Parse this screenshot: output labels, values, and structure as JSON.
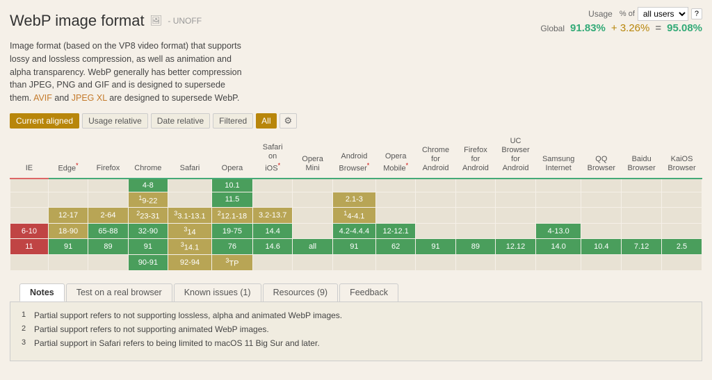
{
  "header": {
    "title": "WebP image format",
    "icon_label": "image-icon",
    "unoff": "- UNOFF",
    "usage_label": "Usage",
    "users_label": "% of  all users",
    "question": "?",
    "global_label": "Global",
    "global_pct1": "91.83%",
    "global_plus": "+ 3.26%",
    "global_eq": "=",
    "global_total": "95.08%"
  },
  "description": {
    "text1": "Image format (based on the VP8 video format) that supports lossy and lossless compression, as well as animation and alpha transparency. WebP generally has better compression than JPEG, PNG and GIF and is designed to supersede them.",
    "link1": "AVIF",
    "text2": " and ",
    "link2": "JPEG XL",
    "text3": " are designed to supersede WebP."
  },
  "controls": {
    "current_aligned": "Current aligned",
    "usage_relative": "Usage relative",
    "date_relative": "Date relative",
    "filtered": "Filtered",
    "all": "All",
    "gear": "⚙"
  },
  "columns": [
    {
      "label": "IE",
      "sub": "",
      "border": "red"
    },
    {
      "label": "Edge",
      "sub": "*",
      "border": "green"
    },
    {
      "label": "Firefox",
      "sub": "",
      "border": "green"
    },
    {
      "label": "Chrome",
      "sub": "",
      "border": "green"
    },
    {
      "label": "Safari",
      "sub": "",
      "border": "green"
    },
    {
      "label": "Opera",
      "sub": "",
      "border": "green"
    },
    {
      "label": "Safari on iOS",
      "sub": "*",
      "border": "green"
    },
    {
      "label": "Opera Mini",
      "sub": "",
      "border": "green"
    },
    {
      "label": "Android Browser",
      "sub": "*",
      "border": "green"
    },
    {
      "label": "Opera Mobile",
      "sub": "*",
      "border": "green"
    },
    {
      "label": "Chrome for Android",
      "sub": "",
      "border": "green"
    },
    {
      "label": "Firefox for Android",
      "sub": "",
      "border": "green"
    },
    {
      "label": "UC Browser for Android",
      "sub": "",
      "border": "green"
    },
    {
      "label": "Samsung Internet",
      "sub": "",
      "border": "green"
    },
    {
      "label": "QQ Browser",
      "sub": "",
      "border": "green"
    },
    {
      "label": "Baidu Browser",
      "sub": "",
      "border": "green"
    },
    {
      "label": "KaiOS Browser",
      "sub": "",
      "border": "green"
    }
  ],
  "rows": [
    {
      "cells": [
        {
          "type": "empty",
          "text": ""
        },
        {
          "type": "empty",
          "text": ""
        },
        {
          "type": "empty",
          "text": ""
        },
        {
          "type": "green",
          "text": "4-8",
          "note": ""
        },
        {
          "type": "empty",
          "text": ""
        },
        {
          "type": "green",
          "text": "10.1",
          "note": ""
        },
        {
          "type": "empty",
          "text": ""
        },
        {
          "type": "empty",
          "text": ""
        },
        {
          "type": "empty",
          "text": ""
        },
        {
          "type": "empty",
          "text": ""
        },
        {
          "type": "empty",
          "text": ""
        },
        {
          "type": "empty",
          "text": ""
        },
        {
          "type": "empty",
          "text": ""
        },
        {
          "type": "empty",
          "text": ""
        },
        {
          "type": "empty",
          "text": ""
        },
        {
          "type": "empty",
          "text": ""
        },
        {
          "type": "empty",
          "text": ""
        }
      ]
    },
    {
      "cells": [
        {
          "type": "empty",
          "text": ""
        },
        {
          "type": "empty",
          "text": ""
        },
        {
          "type": "empty",
          "text": ""
        },
        {
          "type": "yellow",
          "text": "9-22",
          "note": "1"
        },
        {
          "type": "empty",
          "text": ""
        },
        {
          "type": "green",
          "text": "11.5",
          "note": ""
        },
        {
          "type": "empty",
          "text": ""
        },
        {
          "type": "empty",
          "text": ""
        },
        {
          "type": "yellow",
          "text": "2.1-3",
          "note": ""
        },
        {
          "type": "empty",
          "text": ""
        },
        {
          "type": "empty",
          "text": ""
        },
        {
          "type": "empty",
          "text": ""
        },
        {
          "type": "empty",
          "text": ""
        },
        {
          "type": "empty",
          "text": ""
        },
        {
          "type": "empty",
          "text": ""
        },
        {
          "type": "empty",
          "text": ""
        },
        {
          "type": "empty",
          "text": ""
        }
      ]
    },
    {
      "cells": [
        {
          "type": "empty",
          "text": ""
        },
        {
          "type": "yellow",
          "text": "12-17",
          "note": ""
        },
        {
          "type": "yellow",
          "text": "2-64",
          "note": ""
        },
        {
          "type": "yellow",
          "text": "23-31",
          "note": "2"
        },
        {
          "type": "yellow",
          "text": "3.1-13.1",
          "note": "3"
        },
        {
          "type": "yellow",
          "text": "12.1-18",
          "note": "2"
        },
        {
          "type": "yellow",
          "text": "3.2-13.7",
          "note": ""
        },
        {
          "type": "empty",
          "text": ""
        },
        {
          "type": "yellow",
          "text": "4-4.1",
          "note": "1"
        },
        {
          "type": "empty",
          "text": ""
        },
        {
          "type": "empty",
          "text": ""
        },
        {
          "type": "empty",
          "text": ""
        },
        {
          "type": "empty",
          "text": ""
        },
        {
          "type": "empty",
          "text": ""
        },
        {
          "type": "empty",
          "text": ""
        },
        {
          "type": "empty",
          "text": ""
        },
        {
          "type": "empty",
          "text": ""
        }
      ]
    },
    {
      "cells": [
        {
          "type": "red",
          "text": "6-10",
          "note": ""
        },
        {
          "type": "yellow",
          "text": "18-90",
          "note": ""
        },
        {
          "type": "green",
          "text": "65-88",
          "note": ""
        },
        {
          "type": "green",
          "text": "32-90",
          "note": ""
        },
        {
          "type": "yellow",
          "text": "14",
          "note": "3"
        },
        {
          "type": "green",
          "text": "19-75",
          "note": ""
        },
        {
          "type": "green",
          "text": "14.4",
          "note": ""
        },
        {
          "type": "empty",
          "text": ""
        },
        {
          "type": "green",
          "text": "4.2-4.4.4",
          "note": ""
        },
        {
          "type": "green",
          "text": "12-12.1",
          "note": ""
        },
        {
          "type": "empty",
          "text": ""
        },
        {
          "type": "empty",
          "text": ""
        },
        {
          "type": "empty",
          "text": ""
        },
        {
          "type": "green",
          "text": "4-13.0",
          "note": ""
        },
        {
          "type": "empty",
          "text": ""
        },
        {
          "type": "empty",
          "text": ""
        },
        {
          "type": "empty",
          "text": ""
        }
      ]
    },
    {
      "cells": [
        {
          "type": "red",
          "text": "11",
          "note": ""
        },
        {
          "type": "green",
          "text": "91",
          "note": ""
        },
        {
          "type": "green",
          "text": "89",
          "note": ""
        },
        {
          "type": "green",
          "text": "91",
          "note": ""
        },
        {
          "type": "yellow",
          "text": "14.1",
          "note": "3"
        },
        {
          "type": "green",
          "text": "76",
          "note": ""
        },
        {
          "type": "green",
          "text": "14.6",
          "note": ""
        },
        {
          "type": "green",
          "text": "all",
          "note": ""
        },
        {
          "type": "green",
          "text": "91",
          "note": ""
        },
        {
          "type": "green",
          "text": "62",
          "note": ""
        },
        {
          "type": "green",
          "text": "91",
          "note": ""
        },
        {
          "type": "green",
          "text": "89",
          "note": ""
        },
        {
          "type": "green",
          "text": "12.12",
          "note": ""
        },
        {
          "type": "green",
          "text": "14.0",
          "note": ""
        },
        {
          "type": "green",
          "text": "10.4",
          "note": ""
        },
        {
          "type": "green",
          "text": "7.12",
          "note": ""
        },
        {
          "type": "green",
          "text": "2.5",
          "note": ""
        }
      ]
    },
    {
      "cells": [
        {
          "type": "empty",
          "text": ""
        },
        {
          "type": "empty",
          "text": ""
        },
        {
          "type": "empty",
          "text": ""
        },
        {
          "type": "green",
          "text": "90-91",
          "note": ""
        },
        {
          "type": "yellow",
          "text": "92-94",
          "note": ""
        },
        {
          "type": "yellow",
          "text": "TP",
          "note": "3"
        },
        {
          "type": "empty",
          "text": ""
        },
        {
          "type": "empty",
          "text": ""
        },
        {
          "type": "empty",
          "text": ""
        },
        {
          "type": "empty",
          "text": ""
        },
        {
          "type": "empty",
          "text": ""
        },
        {
          "type": "empty",
          "text": ""
        },
        {
          "type": "empty",
          "text": ""
        },
        {
          "type": "empty",
          "text": ""
        },
        {
          "type": "empty",
          "text": ""
        },
        {
          "type": "empty",
          "text": ""
        },
        {
          "type": "empty",
          "text": ""
        }
      ]
    }
  ],
  "tabs": [
    {
      "label": "Notes",
      "active": true
    },
    {
      "label": "Test on a real browser",
      "active": false
    },
    {
      "label": "Known issues (1)",
      "active": false
    },
    {
      "label": "Resources (9)",
      "active": false
    },
    {
      "label": "Feedback",
      "active": false
    }
  ],
  "notes": [
    {
      "num": "1",
      "text": "Partial support refers to not supporting lossless, alpha and animated WebP images."
    },
    {
      "num": "2",
      "text": "Partial support refers to not supporting animated WebP images."
    },
    {
      "num": "3",
      "text": "Partial support in Safari refers to being limited to macOS 11 Big Sur and later."
    }
  ]
}
